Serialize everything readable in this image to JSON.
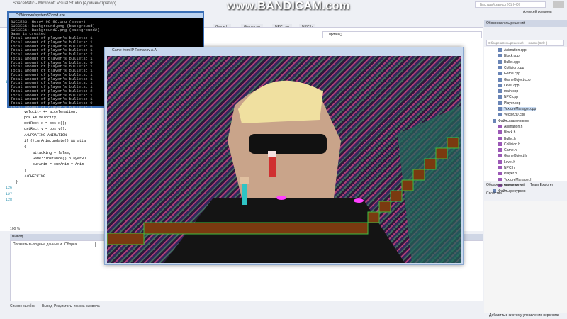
{
  "vs": {
    "title": "SpaceRatic - Microsoft Visual Studio (Администратор)",
    "quick_launch_placeholder": "Быстрый запуск (Ctrl+Q)",
    "user": "Алексей романов"
  },
  "watermark": "www.BANDICAM.com",
  "tabs": [
    "Game.h",
    "Game.cpp",
    "NPC.cpp",
    "NPC.h"
  ],
  "navbar": "update()",
  "code": [
    {
      "n": "100",
      "t": "    {"
    },
    {
      "n": "",
      "t": "        velocity.setX(0);"
    },
    {
      "n": "",
      "t": "        pos.setX(tmpX/\"-32\");"
    },
    {
      "n": "",
      "t": "    }"
    },
    {
      "n": "",
      "t": "    //UPDATING POSITION"
    },
    {
      "n": "",
      "t": "    velocity += acceleration;"
    },
    {
      "n": "",
      "t": "    pos += velocity;"
    },
    {
      "n": "",
      "t": "    dstRect.x = pos.x();"
    },
    {
      "n": "",
      "t": "    dstRect.y = pos.y();"
    },
    {
      "n": "",
      "t": "    //UPDATING ANIMATION"
    },
    {
      "n": "",
      "t": "    if (!curAnim.update() && atta"
    },
    {
      "n": "",
      "t": "    {"
    },
    {
      "n": "",
      "t": "        attacking = false;"
    },
    {
      "n": "",
      "t": "        Game::Instance().playerBu"
    },
    {
      "n": "",
      "t": "        curAnim = curAnim = Anim"
    },
    {
      "n": "",
      "t": "    }"
    },
    {
      "n": "",
      "t": "    //CHECKING"
    },
    {
      "n": "",
      "t": "}"
    },
    {
      "n": "126",
      "t": ""
    },
    {
      "n": "127",
      "t": ""
    },
    {
      "n": "128",
      "t": ""
    }
  ],
  "zoom": "100 %",
  "output": {
    "header": "Вывод",
    "label": "Показать выходные данные из:",
    "source": "Сборка"
  },
  "bottom_tabs": [
    "Список ошибок",
    "Вывод",
    "Результаты поиска символа"
  ],
  "status_right": "Добавить в систему управления версиями",
  "solution_explorer": {
    "header": "Обозреватель решений",
    "search_placeholder": "Обозреватель решений — поиск (Ctrl+;)",
    "cpp_files": [
      "Animation.cpp",
      "Block.cpp",
      "Bullet.cpp",
      "Collision.cpp",
      "Game.cpp",
      "GameObject.cpp",
      "Level.cpp",
      "main.cpp",
      "NPC.cpp",
      "Player.cpp",
      "TextureManager.cpp",
      "Vector2D.cpp"
    ],
    "headers_folder": "Файлы заголовков",
    "h_files": [
      "Animation.h",
      "Block.h",
      "Bullet.h",
      "Collision.h",
      "Game.h",
      "GameObject.h",
      "Level.h",
      "NPC.h",
      "Player.h",
      "TextureManager.h",
      "Vector2D.h"
    ],
    "resources_folder": "Файлы ресурсов",
    "tabs": [
      "Обозреватель решений",
      "Team Explorer"
    ],
    "selected": "TextureManager.cpp"
  },
  "properties": {
    "header": "Свойства"
  },
  "console": {
    "title": "C:\\Windows\\system32\\cmd.exe",
    "lines": [
      "SUCCESS: Hero4_96_96.png (enemy)",
      "SUCCESS: Background.png (background)",
      "SUCCESS: Background2.png (background2)",
      "Game is created",
      "Total amount of player's bullets: 1",
      "Total amount of player's bullets: 1",
      "Total amount of player's bullets: 0",
      "Total amount of player's bullets: 1",
      "Total amount of player's bullets: 2",
      "Total amount of player's bullets: 1",
      "Total amount of player's bullets: 0",
      "Total amount of player's bullets: 1",
      "Total amount of player's bullets: 1",
      "Total amount of player's bullets: 1",
      "Total amount of player's bullets: 1",
      "Total amount of player's bullets: 1",
      "Total amount of player's bullets: 1",
      "Total amount of player's bullets: 2",
      "Total amount of player's bullets: 1",
      "Total amount of player's bullets: 1",
      "Total amount of player's bullets: 0",
      "Total amount of player's bullets: 1"
    ]
  },
  "game": {
    "title": "Game from IP Romanov A.A."
  },
  "colors": {
    "platform": "#7a3a10",
    "platform_edge": "#3fbf3f",
    "vs_accent": "#007acc"
  }
}
